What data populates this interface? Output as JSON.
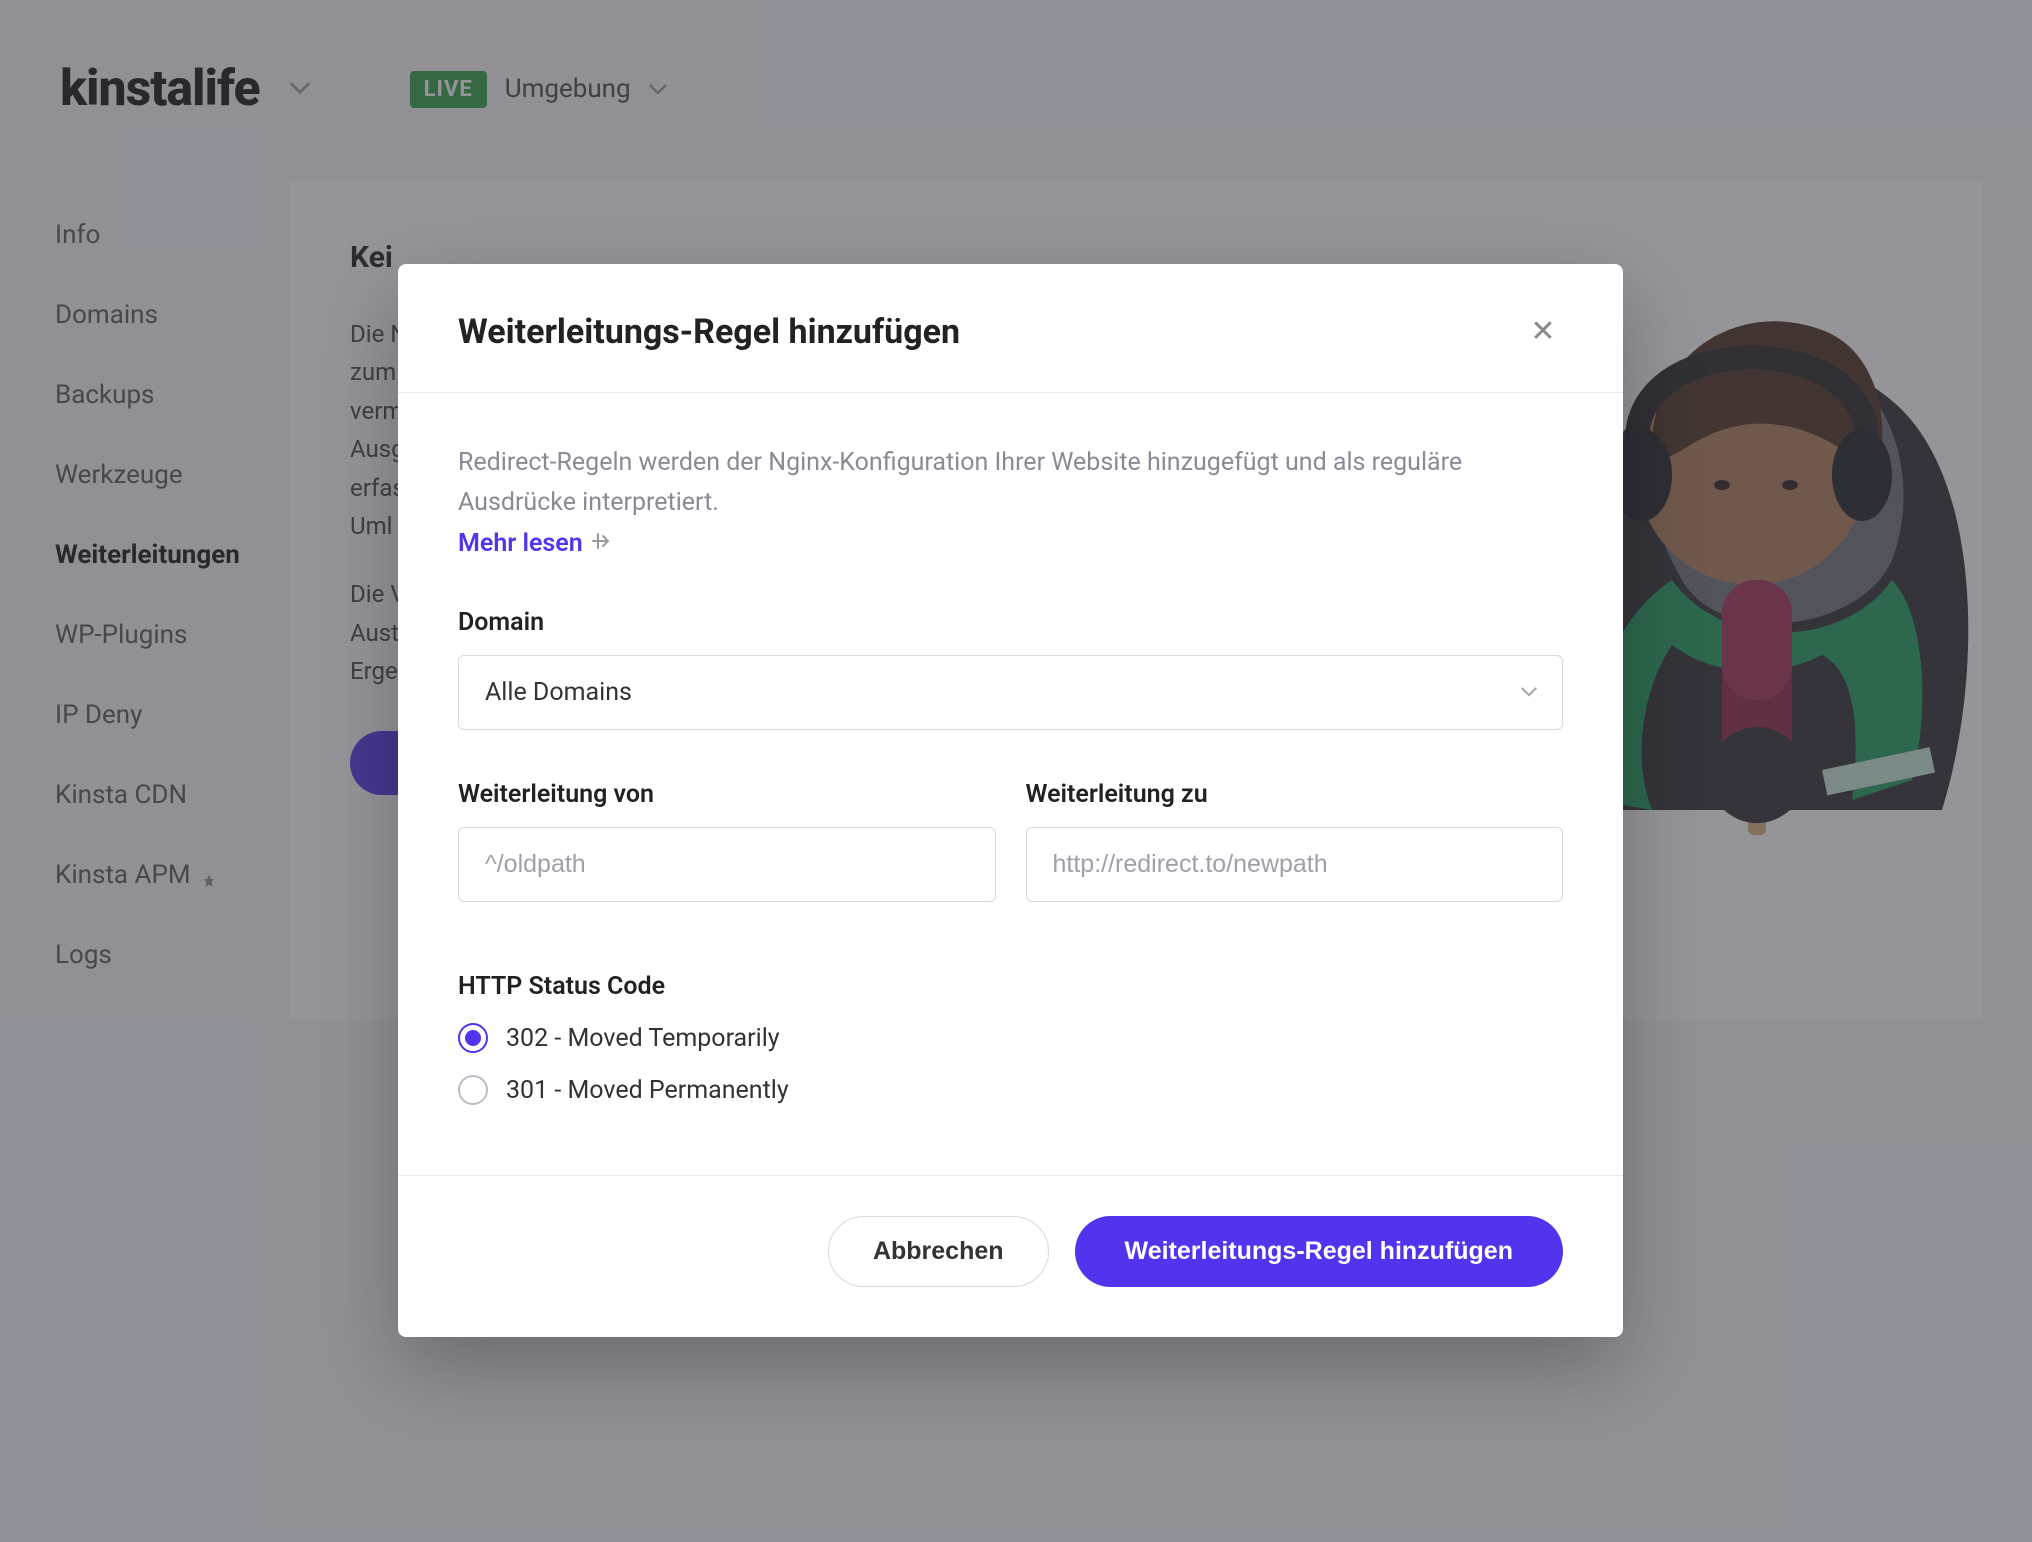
{
  "brand": "kinstalife",
  "env": {
    "badge": "LIVE",
    "label": "Umgebung"
  },
  "sidebar": {
    "items": [
      {
        "label": "Info"
      },
      {
        "label": "Domains"
      },
      {
        "label": "Backups"
      },
      {
        "label": "Werkzeuge"
      },
      {
        "label": "Weiterleitungen"
      },
      {
        "label": "WP-Plugins"
      },
      {
        "label": "IP Deny"
      },
      {
        "label": "Kinsta CDN"
      },
      {
        "label": "Kinsta APM"
      },
      {
        "label": "Logs"
      }
    ],
    "active_index": 4
  },
  "main": {
    "title": "Kei",
    "desc1_lines": [
      "Die N",
      "zum",
      "verm",
      "Ausg",
      "erfas",
      "Uml"
    ],
    "desc2_lines": [
      "Die V",
      "Aust",
      "Erge"
    ]
  },
  "modal": {
    "title": "Weiterleitungs-Regel hinzufügen",
    "desc": "Redirect-Regeln werden der Nginx-Konfiguration Ihrer Website hinzugefügt und als reguläre Ausdrücke interpretiert.",
    "read_more": "Mehr lesen",
    "form": {
      "domain_label": "Domain",
      "domain_value": "Alle Domains",
      "from_label": "Weiterleitung von",
      "from_placeholder": "^/oldpath",
      "to_label": "Weiterleitung zu",
      "to_placeholder": "http://redirect.to/newpath",
      "status_label": "HTTP Status Code",
      "radios": [
        {
          "label": "302 - Moved Temporarily",
          "selected": true
        },
        {
          "label": "301 - Moved Permanently",
          "selected": false
        }
      ]
    },
    "cancel_label": "Abbrechen",
    "submit_label": "Weiterleitungs-Regel hinzufügen"
  },
  "colors": {
    "accent": "#5333ed",
    "live": "#2f9e44"
  }
}
